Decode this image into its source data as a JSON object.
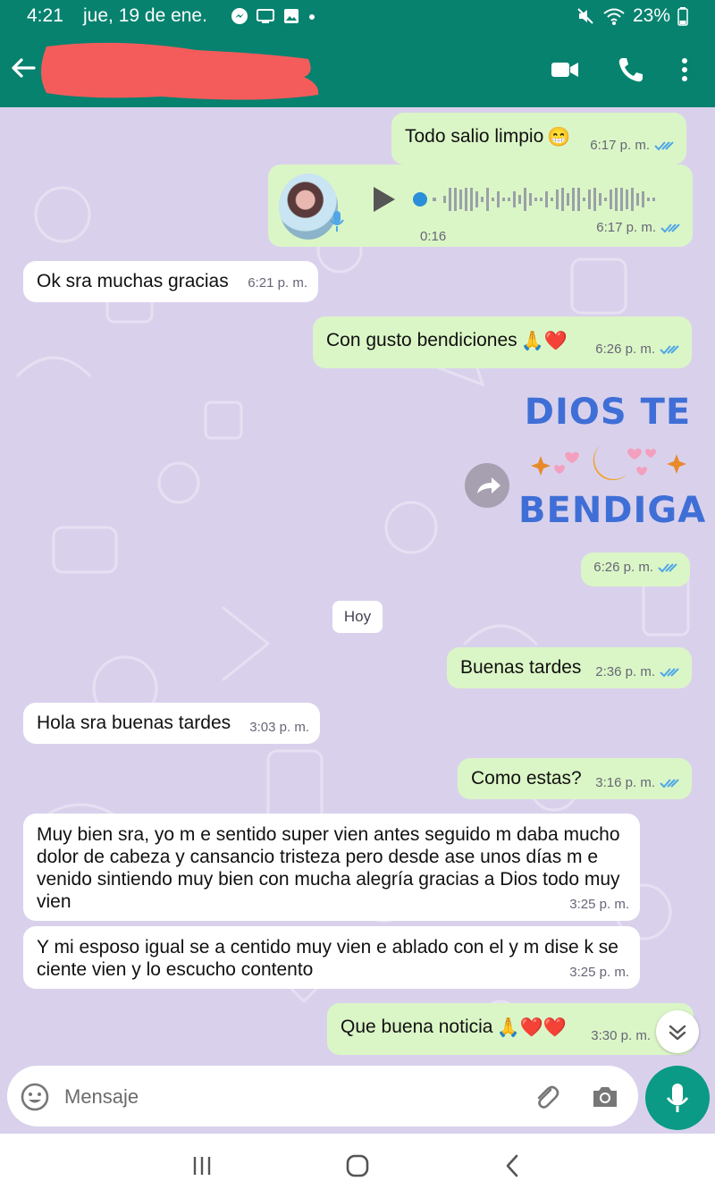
{
  "status": {
    "time": "4:21",
    "date": "jue, 19 de ene.",
    "battery": "23%",
    "icons": [
      "messenger-icon",
      "cast-icon",
      "gallery-icon",
      "dot-icon",
      "mute-icon",
      "wifi-icon",
      "battery-icon"
    ]
  },
  "header": {
    "icons": [
      "back-arrow-icon",
      "video-call-icon",
      "voice-call-icon",
      "more-options-icon"
    ],
    "accent": "#06826f"
  },
  "chat": {
    "messages": [
      {
        "dir": "out",
        "text": "Todo salio limpio",
        "emoji": "😁",
        "time": "6:17 p. m."
      },
      {
        "dir": "out",
        "type": "voice",
        "duration": "0:16",
        "time": "6:17 p. m."
      },
      {
        "dir": "in",
        "text": "Ok sra muchas gracias",
        "time": "6:21 p. m."
      },
      {
        "dir": "out",
        "text": "Con gusto bendiciones",
        "emoji": "🙏❤️",
        "time": "6:26 p. m."
      },
      {
        "dir": "out",
        "type": "sticker",
        "sticker_lines": [
          "DIOS TE",
          "BENDIGA"
        ],
        "time": "6:26 p. m."
      },
      {
        "dir": "out",
        "text": "Buenas tardes",
        "time": "2:36 p. m."
      },
      {
        "dir": "in",
        "text": "Hola sra buenas tardes",
        "time": "3:03 p. m."
      },
      {
        "dir": "out",
        "text": "Como estas?",
        "time": "3:16 p. m."
      },
      {
        "dir": "in",
        "text": "Muy bien sra, yo m e sentido super vien antes  seguido m daba mucho dolor de cabeza y cansancio tristeza pero desde ase unos días m e venido sintiendo muy bien con mucha alegría gracias a Dios todo muy vien",
        "time": "3:25 p. m."
      },
      {
        "dir": "in",
        "text": "Y mi esposo igual se a centido muy vien e ablado con el y m dise k se ciente vien y lo escucho contento",
        "time": "3:25 p. m."
      },
      {
        "dir": "out",
        "text": "Que buena noticia",
        "emoji": "🙏❤️❤️",
        "time": "3:30 p. m."
      }
    ],
    "day_label": "Hoy"
  },
  "composer": {
    "placeholder": "Mensaje",
    "icons": [
      "emoji-icon",
      "attach-icon",
      "camera-icon",
      "mic-icon"
    ]
  },
  "colors": {
    "outgoing": "#dbf6c6",
    "incoming": "#ffffff",
    "wallpaper": "#d9d1ec",
    "read_ticks": "#4fa6e8"
  }
}
